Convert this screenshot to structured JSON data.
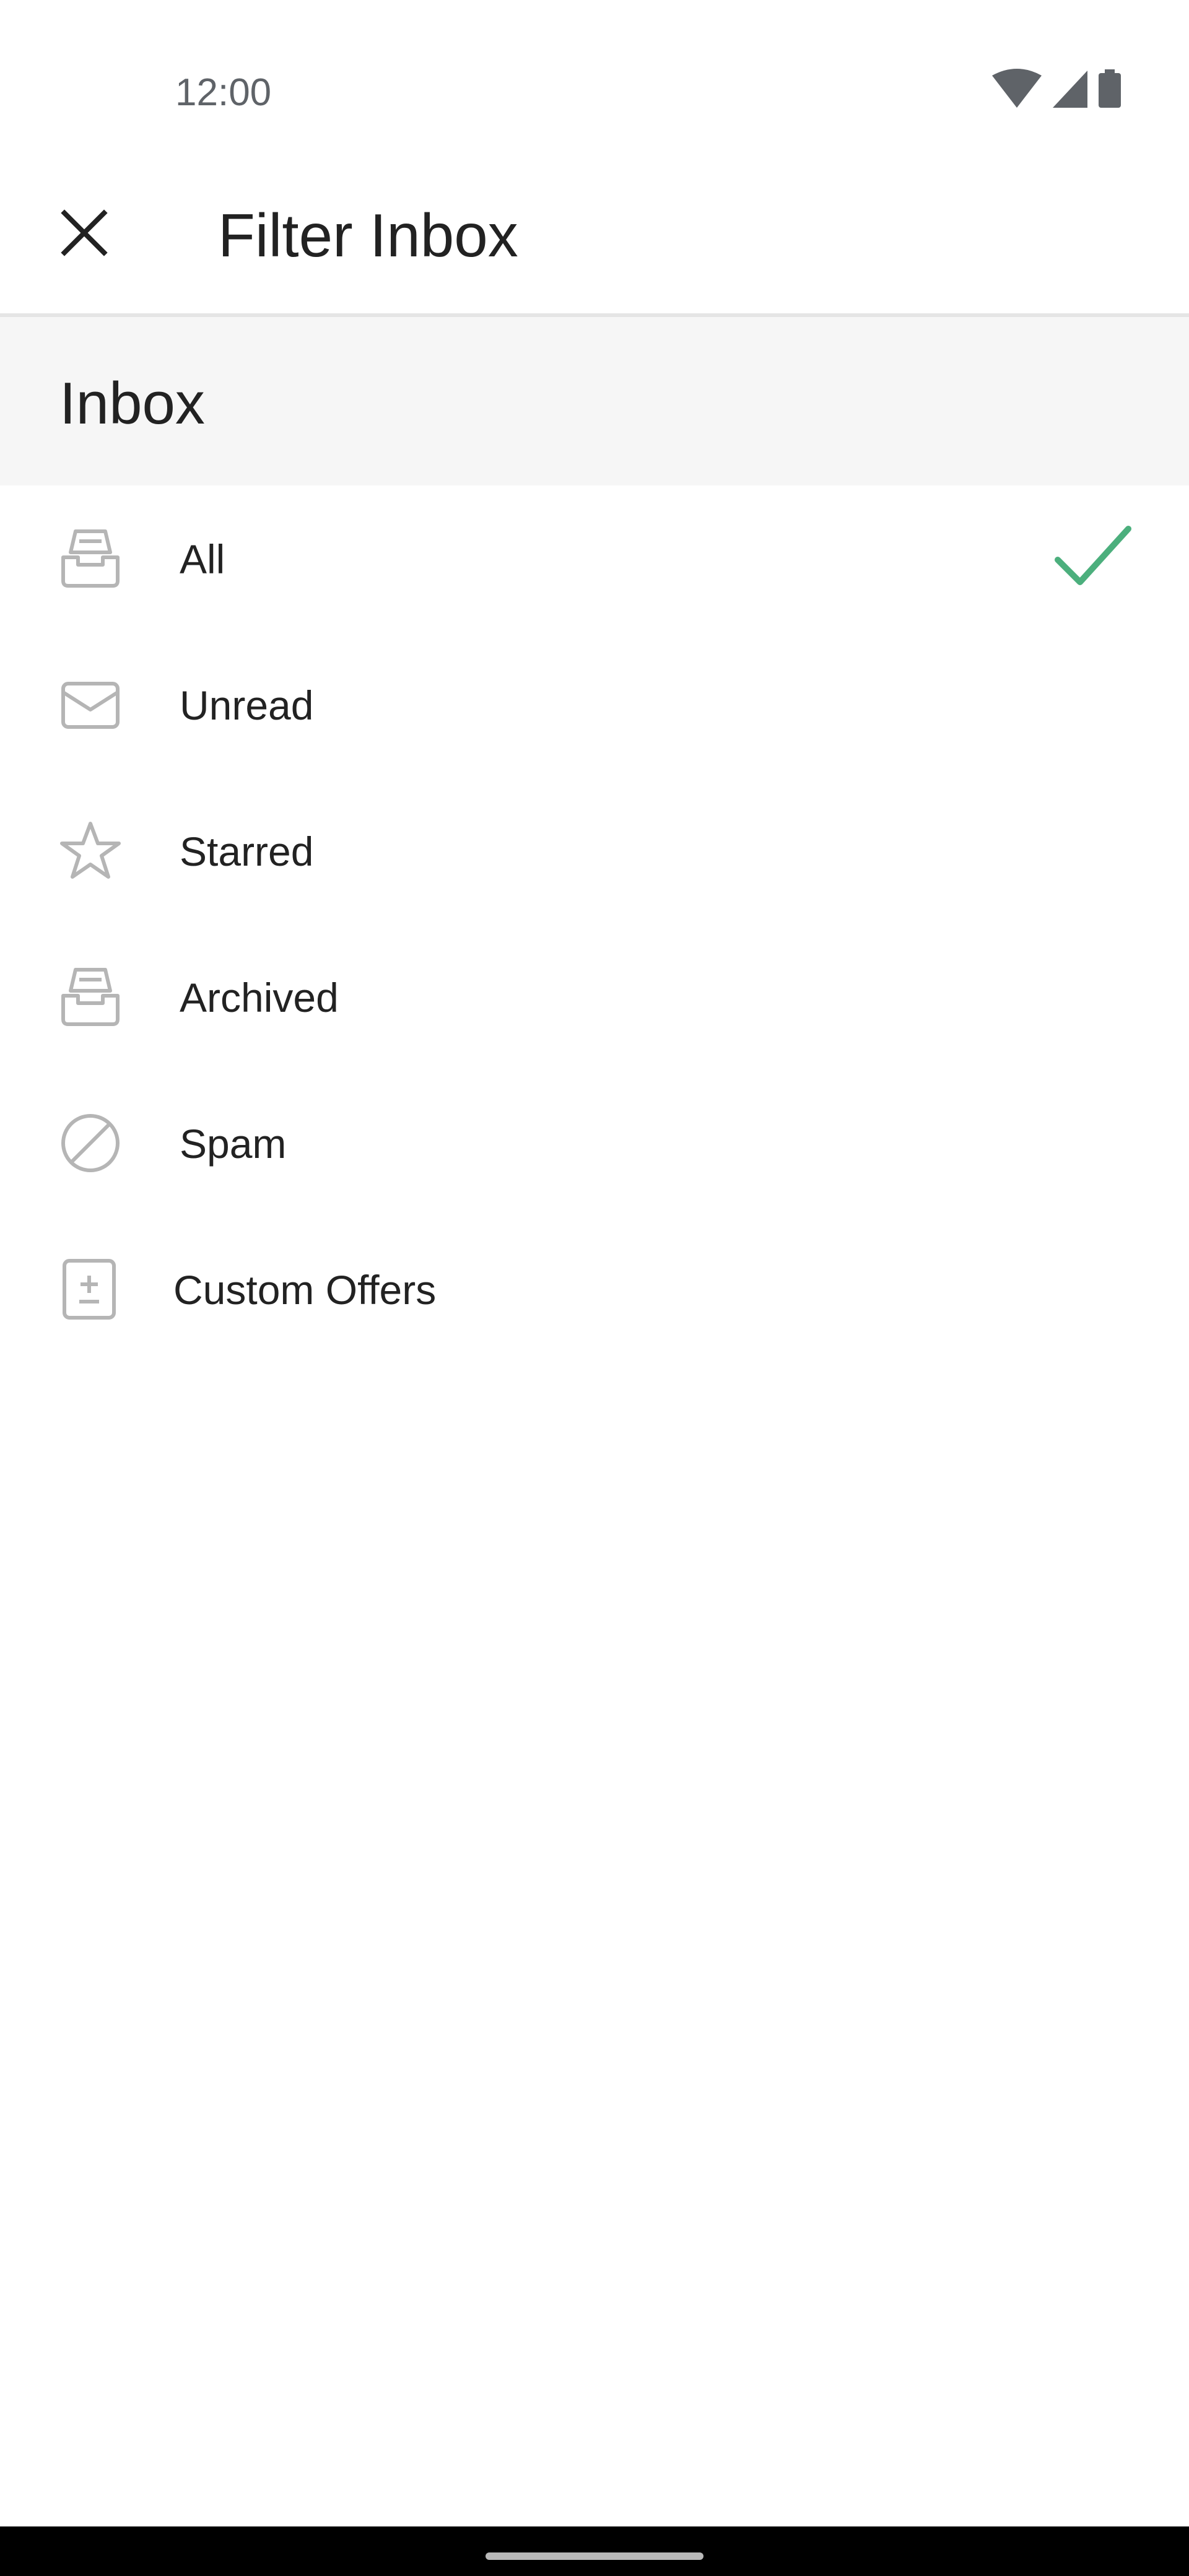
{
  "status_bar": {
    "time": "12:00",
    "icons": [
      "wifi-icon",
      "cellular-signal-icon",
      "battery-icon"
    ]
  },
  "app_bar": {
    "title": "Filter Inbox",
    "close_icon": "close-icon"
  },
  "section": {
    "title": "Inbox"
  },
  "filters": [
    {
      "label": "All",
      "icon": "inbox-tray-icon",
      "selected": true
    },
    {
      "label": "Unread",
      "icon": "envelope-icon",
      "selected": false
    },
    {
      "label": "Starred",
      "icon": "star-icon",
      "selected": false
    },
    {
      "label": "Archived",
      "icon": "archive-tray-icon",
      "selected": false
    },
    {
      "label": "Spam",
      "icon": "block-icon",
      "selected": false
    },
    {
      "label": "Custom Offers",
      "icon": "custom-offer-icon",
      "selected": false
    }
  ],
  "colors": {
    "accent_check": "#4caf7d",
    "icon_gray": "#b5b5b5",
    "text": "#222222",
    "section_bg": "#f6f6f6"
  }
}
